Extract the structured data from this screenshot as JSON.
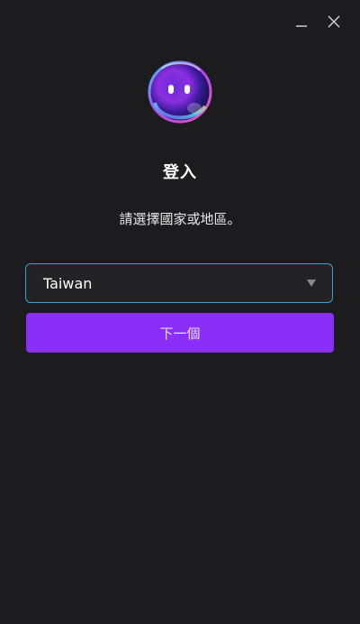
{
  "window": {
    "minimize_icon": "minimize-icon",
    "close_icon": "close-icon"
  },
  "login": {
    "title": "登入",
    "subtitle": "請選擇國家或地區。",
    "country": {
      "selected": "Taiwan",
      "dropdown_icon": "caret-down-icon"
    },
    "next_label": "下一個"
  },
  "colors": {
    "background": "#1c1c1e",
    "accent": "#8b2ff8",
    "select_border": "#3f9fc4"
  }
}
